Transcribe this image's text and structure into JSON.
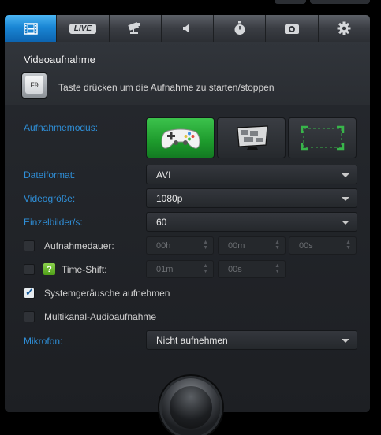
{
  "tabs": [
    {
      "name": "video-tab",
      "icon": "film-icon",
      "active": true
    },
    {
      "name": "live-tab",
      "label": "LIVE",
      "active": false
    },
    {
      "name": "screenshot-tab",
      "icon": "camera-mount-icon",
      "active": false
    },
    {
      "name": "audio-tab",
      "icon": "speaker-icon",
      "active": false
    },
    {
      "name": "timer-tab",
      "icon": "stopwatch-icon",
      "active": false
    },
    {
      "name": "photo-tab",
      "icon": "camera-icon",
      "active": false
    },
    {
      "name": "settings-tab",
      "icon": "gear-icon",
      "active": false
    }
  ],
  "header": {
    "title": "Videoaufnahme",
    "hotkey": "F9",
    "hint": "Taste drücken um die Aufnahme zu starten/stoppen"
  },
  "mode": {
    "label": "Aufnahmemodus:",
    "options": [
      "gamepad-icon",
      "desktop-icon",
      "region-icon"
    ],
    "selected": 0
  },
  "format": {
    "label": "Dateiformat:",
    "value": "AVI"
  },
  "size": {
    "label": "Videogröße:",
    "value": "1080p"
  },
  "fps": {
    "label": "Einzelbilder/s:",
    "value": "60"
  },
  "duration": {
    "label": "Aufnahmedauer:",
    "checked": false,
    "hours": "00h",
    "minutes": "00m",
    "seconds": "00s"
  },
  "timeshift": {
    "label": "Time-Shift:",
    "checked": false,
    "help": "?",
    "minutes": "01m",
    "seconds": "00s"
  },
  "system_sound": {
    "label": "Systemgeräusche aufnehmen",
    "checked": true
  },
  "multichannel": {
    "label": "Multikanal-Audioaufnahme",
    "checked": false
  },
  "mic": {
    "label": "Mikrofon:",
    "value": "Nicht aufnehmen"
  },
  "colors": {
    "accent": "#2f8fd8",
    "active_tab": "#1a86d4",
    "active_mode": "#1d9a2c"
  }
}
